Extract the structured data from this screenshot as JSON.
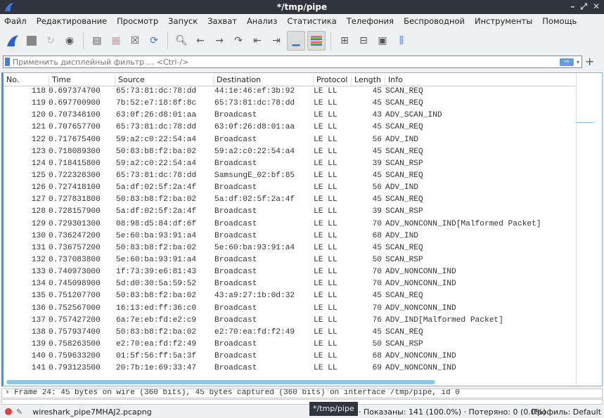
{
  "window": {
    "title": "*/tmp/pipe",
    "min": "–",
    "max": "⤢",
    "close": "✕"
  },
  "menu": [
    "Файл",
    "Редактирование",
    "Просмотр",
    "Запуск",
    "Захват",
    "Анализ",
    "Статистика",
    "Телефония",
    "Беспроводной",
    "Инструменты",
    "Помощь"
  ],
  "filter": {
    "placeholder": "Применить дисплейный фильтр ... <Ctrl-/>",
    "apply": "⇨",
    "dropdown": "▾",
    "add": "+"
  },
  "columns": [
    "No.",
    "Time",
    "Source",
    "Destination",
    "Protocol",
    "Length",
    "Info"
  ],
  "packets": [
    [
      "118",
      "0.697374700",
      "65:73:81:dc:78:dd",
      "44:1e:46:ef:3b:92",
      "LE LL",
      "45",
      "SCAN_REQ"
    ],
    [
      "119",
      "0.697700900",
      "7b:52:e7:18:8f:8c",
      "65:73:81:dc:78:dd",
      "LE LL",
      "45",
      "SCAN_REQ"
    ],
    [
      "120",
      "0.707348100",
      "63:0f:26:d8:01:aa",
      "Broadcast",
      "LE LL",
      "43",
      "ADV_SCAN_IND"
    ],
    [
      "121",
      "0.707657700",
      "65:73:81:dc:78:dd",
      "63:0f:26:d8:01:aa",
      "LE LL",
      "45",
      "SCAN_REQ"
    ],
    [
      "122",
      "0.717675400",
      "59:a2:c0:22:54:a4",
      "Broadcast",
      "LE LL",
      "56",
      "ADV_IND"
    ],
    [
      "123",
      "0.718089300",
      "50:83:b8:f2:ba:02",
      "59:a2:c0:22:54:a4",
      "LE LL",
      "45",
      "SCAN_REQ"
    ],
    [
      "124",
      "0.718415800",
      "59:a2:c0:22:54:a4",
      "Broadcast",
      "LE LL",
      "39",
      "SCAN_RSP"
    ],
    [
      "125",
      "0.722328300",
      "65:73:81:dc:78:dd",
      "SamsungE_02:bf:85",
      "LE LL",
      "45",
      "SCAN_REQ"
    ],
    [
      "126",
      "0.727418100",
      "5a:df:02:5f:2a:4f",
      "Broadcast",
      "LE LL",
      "56",
      "ADV_IND"
    ],
    [
      "127",
      "0.727831800",
      "50:83:b8:f2:ba:02",
      "5a:df:02:5f:2a:4f",
      "LE LL",
      "45",
      "SCAN_REQ"
    ],
    [
      "128",
      "0.728157900",
      "5a:df:02:5f:2a:4f",
      "Broadcast",
      "LE LL",
      "39",
      "SCAN_RSP"
    ],
    [
      "129",
      "0.729301300",
      "08:98:d5:84:df:6f",
      "Broadcast",
      "LE LL",
      "70",
      "ADV_NONCONN_IND[Malformed Packet]"
    ],
    [
      "130",
      "0.736247200",
      "5e:60:ba:93:91:a4",
      "Broadcast",
      "LE LL",
      "68",
      "ADV_IND"
    ],
    [
      "131",
      "0.736757200",
      "50:83:b8:f2:ba:02",
      "5e:60:ba:93:91:a4",
      "LE LL",
      "45",
      "SCAN_REQ"
    ],
    [
      "132",
      "0.737083800",
      "5e:60:ba:93:91:a4",
      "Broadcast",
      "LE LL",
      "50",
      "SCAN_RSP"
    ],
    [
      "133",
      "0.740973000",
      "1f:73:39:e6:81:43",
      "Broadcast",
      "LE LL",
      "70",
      "ADV_NONCONN_IND"
    ],
    [
      "134",
      "0.745098900",
      "5d:d0:30:5a:59:52",
      "Broadcast",
      "LE LL",
      "70",
      "ADV_NONCONN_IND"
    ],
    [
      "135",
      "0.751207700",
      "50:83:b8:f2:ba:02",
      "43:a9:27:1b:0d:32",
      "LE LL",
      "45",
      "SCAN_REQ"
    ],
    [
      "136",
      "0.752567000",
      "16:13:ed:ff:36:c0",
      "Broadcast",
      "LE LL",
      "70",
      "ADV_NONCONN_IND"
    ],
    [
      "137",
      "0.757427200",
      "6a:7e:eb:fd:e2:c9",
      "Broadcast",
      "LE LL",
      "76",
      "ADV_IND[Malformed Packet]"
    ],
    [
      "138",
      "0.757937400",
      "50:83:b8:f2:ba:02",
      "e2:70:ea:fd:f2:49",
      "LE LL",
      "45",
      "SCAN_REQ"
    ],
    [
      "139",
      "0.758263500",
      "e2:70:ea:fd:f2:49",
      "Broadcast",
      "LE LL",
      "50",
      "SCAN_RSP"
    ],
    [
      "140",
      "0.759633200",
      "01:5f:56:ff:5a:3f",
      "Broadcast",
      "LE LL",
      "68",
      "ADV_NONCONN_IND"
    ],
    [
      "141",
      "0.793123500",
      "20:7b:1e:69:33:47",
      "Broadcast",
      "LE LL",
      "69",
      "ADV_NONCONN_IND"
    ]
  ],
  "detail": "› Frame 24: 45 bytes on wire (360 bits), 45 bytes captured (360 bits) on interface /tmp/pipe, id 0",
  "status": {
    "file": "wireshark_pipe7MHAJ2.pcapng",
    "stats": "· Показаны: 141 (100.0%) · Потеряно: 0 (0.0%)",
    "profile": "Профиль: Default",
    "tooltip": "*/tmp/pipe"
  }
}
